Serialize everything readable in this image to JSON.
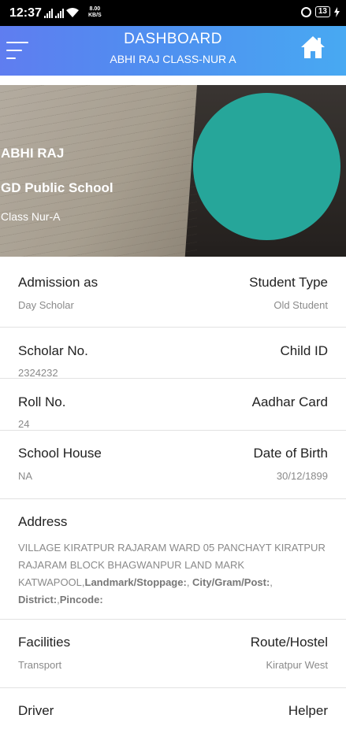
{
  "status_bar": {
    "time": "12:37",
    "speed_value": "8.00",
    "speed_unit": "KB/S",
    "battery": "13",
    "icons": [
      "signal-icon",
      "signal-icon",
      "wifi-icon",
      "screen-lock-icon",
      "battery-icon",
      "charging-icon"
    ]
  },
  "app_bar": {
    "title": "DASHBOARD",
    "subtitle": "ABHI RAJ CLASS-NUR A",
    "icons": [
      "menu-icon",
      "home-icon"
    ]
  },
  "profile": {
    "name": "ABHI RAJ",
    "school": "GD Public School",
    "class": "Class Nur-A",
    "avatar_color": "#26a69a"
  },
  "details": {
    "admission_label": "Admission as",
    "admission_value": "Day Scholar",
    "student_type_label": "Student Type",
    "student_type_value": "Old Student",
    "scholar_label": "Scholar No.",
    "scholar_value": "2324232",
    "child_id_label": "Child ID",
    "roll_label": "Roll No.",
    "roll_value": "24",
    "aadhar_label": "Aadhar Card",
    "house_label": "School House",
    "house_value": "NA",
    "dob_label": "Date of Birth",
    "dob_value": "30/12/1899",
    "address_label": "Address",
    "address_text": "VILLAGE KIRATPUR RAJARAM WARD 05 PANCHAYT KIRATPUR RAJARAM BLOCK BHAGWANPUR LAND MARK KATWAPOOL,",
    "address_landmark": "Landmark/Stoppage:",
    "address_city": "City/Gram/Post:",
    "address_district": "District:",
    "address_pincode": "Pincode:",
    "facilities_label": "Facilities",
    "facilities_value": "Transport",
    "route_label": "Route/Hostel",
    "route_value": "Kiratpur West",
    "driver_label": "Driver",
    "helper_label": "Helper"
  },
  "colors": {
    "app_bar_start": "#5f7df0",
    "app_bar_end": "#48a9f2",
    "avatar": "#26a69a"
  }
}
